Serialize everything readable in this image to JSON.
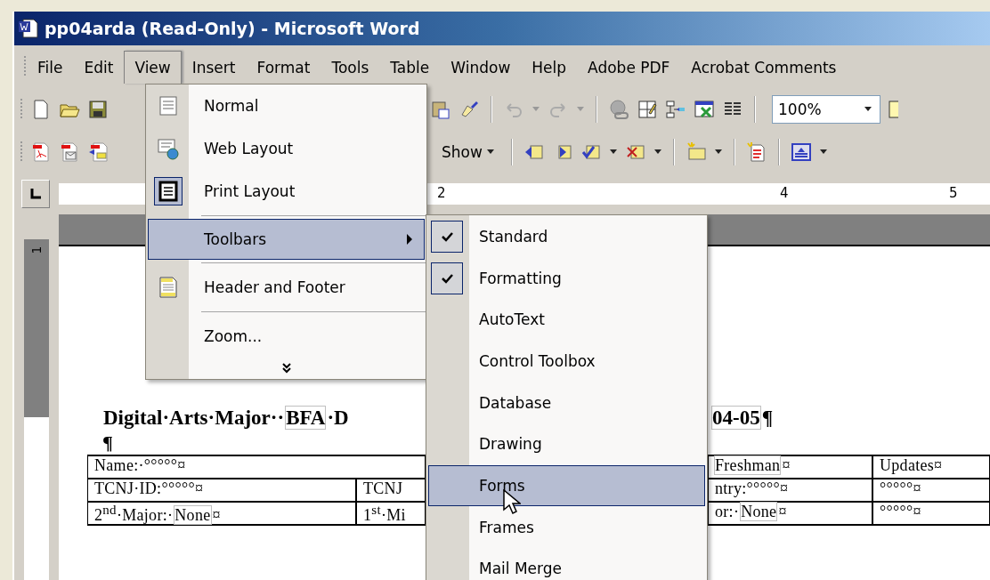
{
  "window": {
    "title": "pp04arda (Read-Only) - Microsoft Word"
  },
  "menu_bar": [
    {
      "label": "File",
      "selected": false
    },
    {
      "label": "Edit",
      "selected": false
    },
    {
      "label": "View",
      "selected": true
    },
    {
      "label": "Insert",
      "selected": false
    },
    {
      "label": "Format",
      "selected": false
    },
    {
      "label": "Tools",
      "selected": false
    },
    {
      "label": "Table",
      "selected": false
    },
    {
      "label": "Window",
      "selected": false
    },
    {
      "label": "Help",
      "selected": false
    },
    {
      "label": "Adobe PDF",
      "selected": false
    },
    {
      "label": "Acrobat Comments",
      "selected": false
    }
  ],
  "standard_toolbar": {
    "zoom": "100%"
  },
  "reviewing_toolbar": {
    "show": "Show"
  },
  "ruler": {
    "numbers": [
      "2",
      "4",
      "5"
    ]
  },
  "vertical_ruler": {
    "number": "1"
  },
  "document": {
    "heading_left": [
      {
        "text": "Digital·Arts·Major··",
        "field": false
      },
      {
        "text": "BFA",
        "field": true
      },
      {
        "text": "·D",
        "field": false
      }
    ],
    "heading_right": [
      {
        "text": "04-05",
        "field": true
      },
      {
        "text": "¶",
        "field": false
      }
    ],
    "pilcrow": "¶",
    "table": {
      "rows": [
        {
          "cells": [
            {
              "kind": "wide",
              "segments": [
                {
                  "text": "Name:·°°°°°¤",
                  "field": false
                }
              ]
            },
            {
              "kind": "spanned"
            },
            {
              "kind": "hidden"
            },
            {
              "kind": "plain",
              "segments": [
                {
                  "text": "Freshman",
                  "field": true
                },
                {
                  "text": "¤",
                  "field": false
                }
              ]
            },
            {
              "kind": "plain",
              "segments": [
                {
                  "text": "Updates¤",
                  "field": false
                }
              ]
            }
          ]
        },
        {
          "cells": [
            {
              "kind": "plain",
              "segments": [
                {
                  "text": "TCNJ·ID:°°°°°¤",
                  "field": false
                }
              ]
            },
            {
              "kind": "plain",
              "segments": [
                {
                  "text": "TCNJ",
                  "field": false
                }
              ]
            },
            {
              "kind": "hidden"
            },
            {
              "kind": "plain",
              "segments": [
                {
                  "text": "ntry:°°°°°¤",
                  "field": false
                }
              ]
            },
            {
              "kind": "plain",
              "segments": [
                {
                  "text": "°°°°°¤",
                  "field": false
                }
              ]
            }
          ]
        },
        {
          "cells": [
            {
              "kind": "plain",
              "segments": [
                {
                  "text": "2$^{nd}$·Major:·",
                  "field": false
                },
                {
                  "text": "None",
                  "field": true
                },
                {
                  "text": "¤",
                  "field": false
                }
              ]
            },
            {
              "kind": "plain",
              "segments": [
                {
                  "text": "1$^{st}$·Mi",
                  "field": false
                }
              ]
            },
            {
              "kind": "hidden"
            },
            {
              "kind": "plain",
              "segments": [
                {
                  "text": "or:·",
                  "field": false
                },
                {
                  "text": "None",
                  "field": true
                },
                {
                  "text": "¤",
                  "field": false
                }
              ]
            },
            {
              "kind": "plain",
              "segments": [
                {
                  "text": "°°°°°¤",
                  "field": false
                }
              ]
            }
          ]
        }
      ]
    }
  },
  "view_menu": {
    "items": [
      {
        "kind": "normal-view",
        "label": "Normal",
        "checked": false,
        "selected": false
      },
      {
        "kind": "web-view",
        "label": "Web Layout",
        "checked": false,
        "selected": false
      },
      {
        "kind": "print-view",
        "label": "Print Layout",
        "checked": true,
        "selected": false
      },
      {
        "kind": "separator"
      },
      {
        "kind": "submenu",
        "label": "Toolbars",
        "checked": false,
        "selected": true
      },
      {
        "kind": "separator"
      },
      {
        "kind": "header-footer",
        "label": "Header and Footer",
        "checked": false,
        "selected": false
      },
      {
        "kind": "separator"
      },
      {
        "kind": "plain",
        "label": "Zoom...",
        "checked": false,
        "selected": false
      },
      {
        "kind": "expand"
      }
    ]
  },
  "toolbars_menu": {
    "items": [
      {
        "label": "Standard",
        "checked": true,
        "selected": false
      },
      {
        "label": "Formatting",
        "checked": true,
        "selected": false
      },
      {
        "label": "AutoText",
        "checked": false,
        "selected": false
      },
      {
        "label": "Control Toolbox",
        "checked": false,
        "selected": false
      },
      {
        "label": "Database",
        "checked": false,
        "selected": false
      },
      {
        "label": "Drawing",
        "checked": false,
        "selected": false
      },
      {
        "label": "Forms",
        "checked": false,
        "selected": true
      },
      {
        "label": "Frames",
        "checked": false,
        "selected": false
      },
      {
        "label": "Mail Merge",
        "checked": false,
        "selected": false
      }
    ]
  }
}
